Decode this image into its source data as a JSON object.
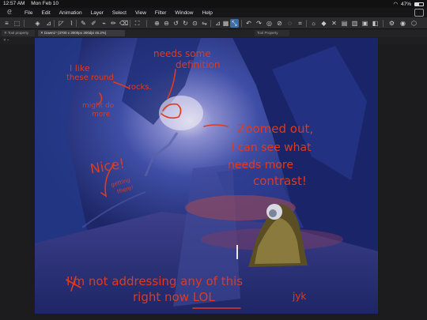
{
  "status_bar": {
    "time": "12:57 AM",
    "date": "Mon Feb 10",
    "battery_percent": "47%",
    "battery_level": 0.47
  },
  "menu": {
    "items": [
      "File",
      "Edit",
      "Animation",
      "Layer",
      "Select",
      "View",
      "Filter",
      "Window",
      "Help"
    ]
  },
  "tabs": {
    "panel_tab": "Tool property",
    "document_tab": "Dawn1* (3700 x 3000px 300dpi 46.2%)",
    "right_tab": "Tool Property",
    "panel_label": "Tool"
  },
  "annotations": {
    "rocks_line1": "I like",
    "rocks_line2": "these round",
    "rocks_line3": "rocks.",
    "might_line1": "might do",
    "might_line2": "more",
    "needs_line1": "needs some",
    "needs_line2": "definition",
    "nice": "Nice!",
    "getting_line1": "getting",
    "getting_line2": "there!",
    "zoomed_line1": "Zoomed out,",
    "zoomed_line2": "I can see what",
    "zoomed_line3": "needs more",
    "zoomed_line4": "contrast!",
    "bottom_line1": "I'm not addressing any of this",
    "bottom_line2": "right now LOL",
    "signature": "jyk"
  },
  "colors": {
    "annotation_red": "#e03a1e",
    "active_tool": "#3b6fa6",
    "toolbar_bg": "#2b2b2e"
  }
}
